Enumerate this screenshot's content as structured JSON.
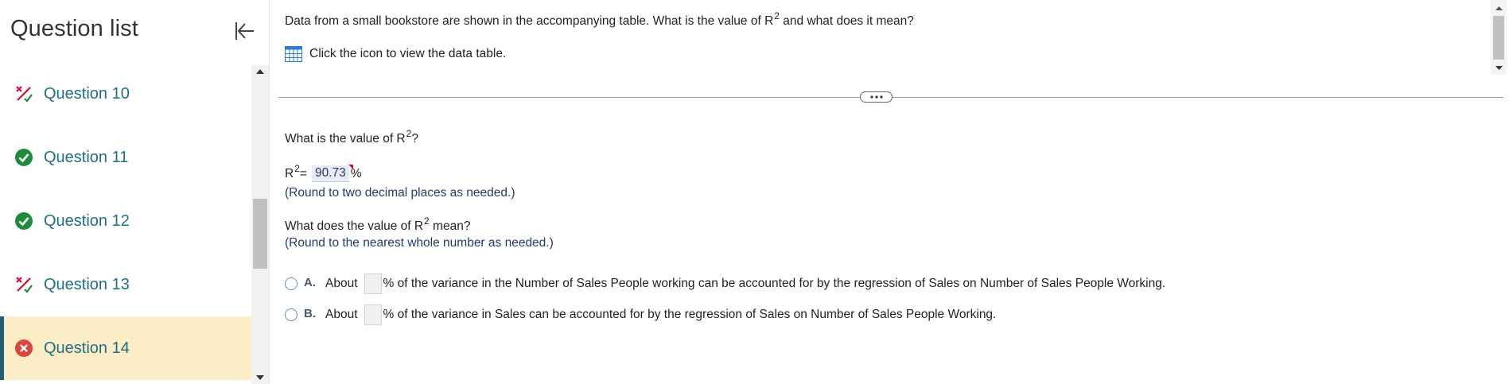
{
  "sidebar": {
    "title": "Question list",
    "collapse_icon": "collapse-left-icon",
    "questions": [
      {
        "label": "Question 10",
        "status": "partial",
        "icon": "partial-credit-icon"
      },
      {
        "label": "Question 11",
        "status": "correct",
        "icon": "check-circle-icon"
      },
      {
        "label": "Question 12",
        "status": "correct",
        "icon": "check-circle-icon"
      },
      {
        "label": "Question 13",
        "status": "partial",
        "icon": "partial-credit-icon"
      },
      {
        "label": "Question 14",
        "status": "incorrect",
        "icon": "x-circle-icon",
        "active": true
      }
    ]
  },
  "question": {
    "stem_before": "Data from a small bookstore are shown in the accompanying table. What is the value of R",
    "stem_sup": "2",
    "stem_after": " and what does it mean?",
    "data_link_text": "Click the icon to view the data table.",
    "data_icon": "table-icon",
    "part1": {
      "prompt_before": "What is the value of R",
      "prompt_sup": "2",
      "prompt_after": "?",
      "answer_prefix": "R",
      "answer_sup": "2",
      "answer_eq": " =",
      "answer_value": "90.73",
      "answer_unit": "%",
      "round_note": "(Round to two decimal places as needed.)"
    },
    "part2": {
      "prompt_before": "What does the value of R",
      "prompt_sup": "2",
      "prompt_after": " mean?",
      "round_note": "(Round to the nearest whole number as needed.)",
      "options": [
        {
          "letter": "A.",
          "about": "About",
          "text": "% of the variance in the Number of Sales People working can be accounted for by the regression of Sales on Number of Sales People Working."
        },
        {
          "letter": "B.",
          "about": "About",
          "text": "% of the variance in Sales can be accounted for by the regression of Sales on Number of Sales People Working."
        }
      ]
    }
  },
  "colors": {
    "accent": "#1d6f86",
    "active_bg": "#fbedc5",
    "correct": "#1e8a3c",
    "incorrect": "#d9463b",
    "partial": "#c8102e"
  }
}
